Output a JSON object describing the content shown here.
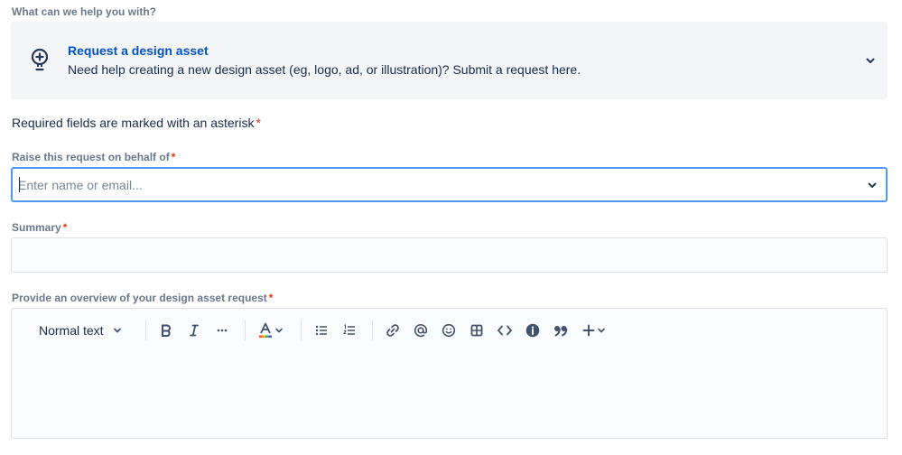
{
  "request_type": {
    "section_label": "What can we help you with?",
    "title": "Request a design asset",
    "description": "Need help creating a new design asset (eg, logo, ad, or illustration)? Submit a request here.",
    "icon": "lightbulb-icon"
  },
  "required_note": "Required fields are marked with an asterisk",
  "asterisk": "*",
  "behalf": {
    "label": "Raise this request on behalf of",
    "placeholder": "Enter name or email..."
  },
  "summary": {
    "label": "Summary",
    "value": ""
  },
  "overview": {
    "label": "Provide an overview of your design asset request",
    "value": ""
  },
  "toolbar": {
    "text_style": "Normal text",
    "more": "···",
    "quote": "99"
  },
  "colors": {
    "link": "#0052cc",
    "focus_border": "#4c9aff",
    "required": "#de350b"
  }
}
